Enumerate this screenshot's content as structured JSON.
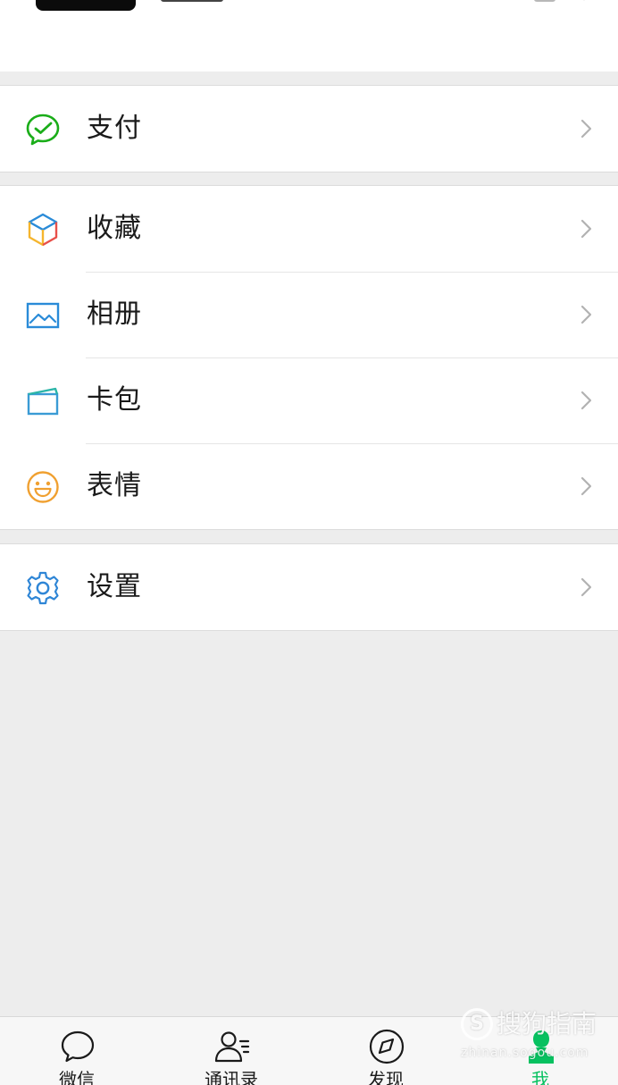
{
  "profile_header": {
    "cropped": true
  },
  "menu_groups": [
    {
      "items": [
        {
          "label": "支付",
          "icon": "wechat-pay-icon"
        }
      ]
    },
    {
      "items": [
        {
          "label": "收藏",
          "icon": "favorites-cube-icon"
        },
        {
          "label": "相册",
          "icon": "photo-album-icon"
        },
        {
          "label": "卡包",
          "icon": "card-wallet-icon"
        },
        {
          "label": "表情",
          "icon": "smiley-face-icon"
        }
      ]
    },
    {
      "items": [
        {
          "label": "设置",
          "icon": "gear-icon"
        }
      ]
    }
  ],
  "tabbar": {
    "tabs": [
      {
        "label": "微信",
        "icon": "chat-bubble-icon",
        "active": false
      },
      {
        "label": "通讯录",
        "icon": "contacts-icon",
        "active": false
      },
      {
        "label": "发现",
        "icon": "compass-icon",
        "active": false
      },
      {
        "label": "我",
        "icon": "me-person-icon",
        "active": true
      }
    ]
  },
  "watermark": {
    "logo_letter": "S",
    "text": "搜狗指南",
    "url": "zhinan.sogou.com"
  },
  "colors": {
    "accent_green": "#07c160",
    "pay_green": "#1aad19",
    "album_blue": "#2a8bd8",
    "card_blue": "#3a9bd5",
    "smiley_orange": "#f0a030",
    "settings_blue": "#2f86d6",
    "background": "#ededed",
    "chevron_gray": "#b2b2b2"
  }
}
